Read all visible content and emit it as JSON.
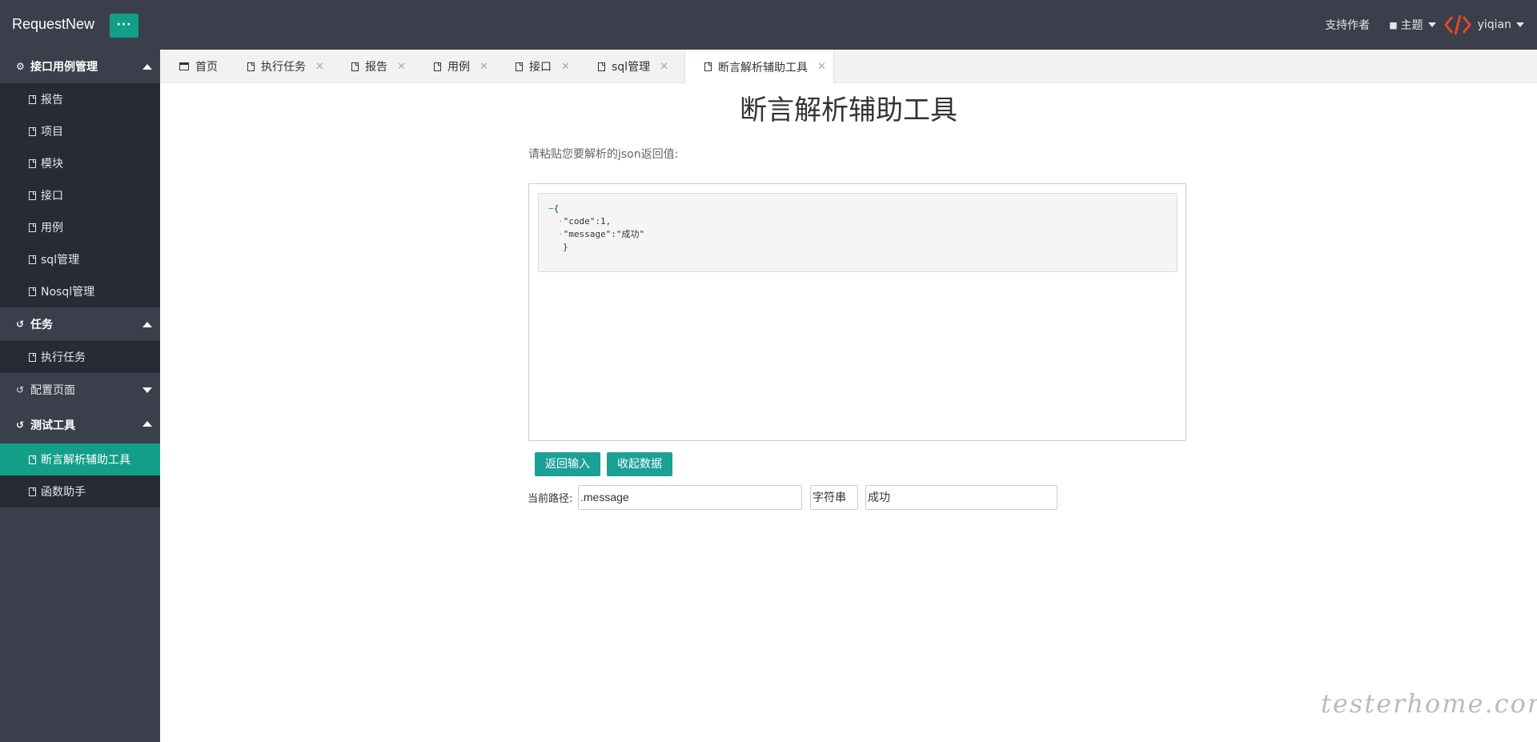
{
  "header": {
    "logo": "RequestNew",
    "menu_button": "···",
    "support": "支持作者",
    "theme": "主题",
    "user": "yiqian"
  },
  "sidebar": {
    "groups": [
      {
        "label": "接口用例管理",
        "expanded": true,
        "items": [
          "报告",
          "项目",
          "模块",
          "接口",
          "用例",
          "sql管理",
          "Nosql管理"
        ]
      },
      {
        "label": "任务",
        "expanded": true,
        "items": [
          "执行任务"
        ]
      },
      {
        "label": "配置页面",
        "expanded": false,
        "items": []
      },
      {
        "label": "测试工具",
        "expanded": true,
        "items": [
          "断言解析辅助工具",
          "函数助手"
        ]
      }
    ],
    "active_item": "断言解析辅助工具"
  },
  "tabs": [
    {
      "label": "首页",
      "closable": false
    },
    {
      "label": "执行任务",
      "closable": true
    },
    {
      "label": "报告",
      "closable": true
    },
    {
      "label": "用例",
      "closable": true
    },
    {
      "label": "接口",
      "closable": true
    },
    {
      "label": "sql管理",
      "closable": true
    },
    {
      "label": "断言解析辅助工具",
      "closable": true,
      "active": true
    }
  ],
  "main": {
    "title": "断言解析辅助工具",
    "paste_label": "请粘贴您要解析的json返回值:",
    "json_lines": [
      "{",
      "\"code\":1,",
      "\"message\":\"成功\"",
      "}"
    ],
    "back_button": "返回输入",
    "collapse_button": "收起数据",
    "path_label": "当前路径:",
    "path_value": ".message",
    "type_value": "字符串",
    "result_value": "成功"
  },
  "watermark": "testerhome.com",
  "colors": {
    "header_bg": "#3a3f4b",
    "accent": "#139f87",
    "submenu_bg": "#262b35"
  }
}
